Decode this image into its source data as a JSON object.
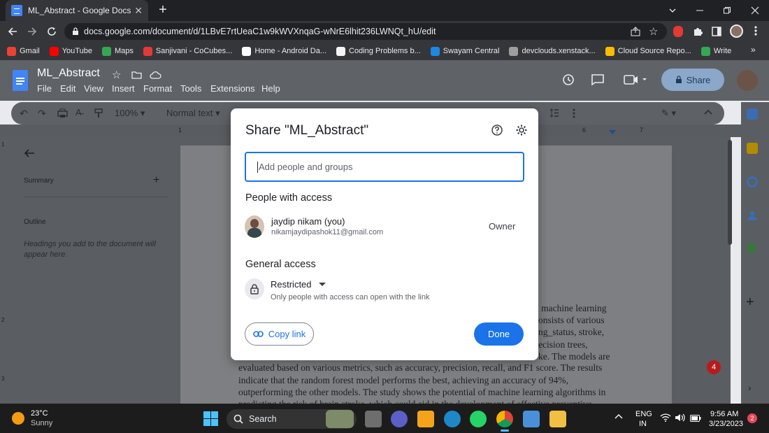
{
  "browser": {
    "tab_title": "ML_Abstract - Google Docs",
    "url": "docs.google.com/document/d/1LBvE7rtUeaC1w9kWVXnqaG-wNrE6lhit236LWNQt_hU/edit",
    "bookmarks": [
      {
        "label": "Gmail",
        "color": "#ea4335"
      },
      {
        "label": "YouTube",
        "color": "#ff0000"
      },
      {
        "label": "Maps",
        "color": "#34a853"
      },
      {
        "label": "Sanjivani - CoCubes...",
        "color": "#e53935"
      },
      {
        "label": "Home - Android Da...",
        "color": "#ffffff"
      },
      {
        "label": "Coding Problems b...",
        "color": "#f5f5f5"
      },
      {
        "label": "Swayam Central",
        "color": "#1e88e5"
      },
      {
        "label": "devclouds.xenstack...",
        "color": "#9e9e9e"
      },
      {
        "label": "Cloud Source Repo...",
        "color": "#fbbc04"
      },
      {
        "label": "Write",
        "color": "#34a853"
      }
    ]
  },
  "docs": {
    "title": "ML_Abstract",
    "menu": [
      "File",
      "Edit",
      "View",
      "Insert",
      "Format",
      "Tools",
      "Extensions",
      "Help"
    ],
    "share_label": "Share",
    "zoom": "100%",
    "style": "Normal text",
    "summary_label": "Summary",
    "outline_label": "Outline",
    "outline_hint": "Headings you add to the document will appear here.",
    "ruler_marks": [
      "1",
      "6",
      "7"
    ],
    "margin_marks": [
      "1",
      "2",
      "3"
    ],
    "body_lines": [
      "t machine learning",
      "onsists of various",
      "ng_status, stroke,",
      "ecision trees,",
      "ke. The models are",
      "evaluated based on various metrics, such as accuracy, precision, recall, and F1 score. The results",
      "indicate that the random forest model performs the best, achieving an accuracy of 94%,",
      "outperforming the other models. The study shows the potential of machine learning algorithms in",
      "predicting the risk of brain stroke, which could aid in the development of effective preventive"
    ]
  },
  "share_dialog": {
    "title": "Share \"ML_Abstract\"",
    "input_placeholder": "Add people and groups",
    "people_heading": "People with access",
    "owner_name": "jaydip nikam (you)",
    "owner_email": "nikamjaydipashok11@gmail.com",
    "owner_role": "Owner",
    "general_heading": "General access",
    "access_level": "Restricted",
    "access_desc": "Only people with access can open with the link",
    "copy_link_label": "Copy link",
    "done_label": "Done"
  },
  "taskbar": {
    "temperature": "23°C",
    "weather": "Sunny",
    "search_label": "Search",
    "lang_line1": "ENG",
    "lang_line2": "IN",
    "time": "9:56 AM",
    "date": "3/23/2023",
    "notification_count": "2",
    "chrome_badge": "4"
  }
}
